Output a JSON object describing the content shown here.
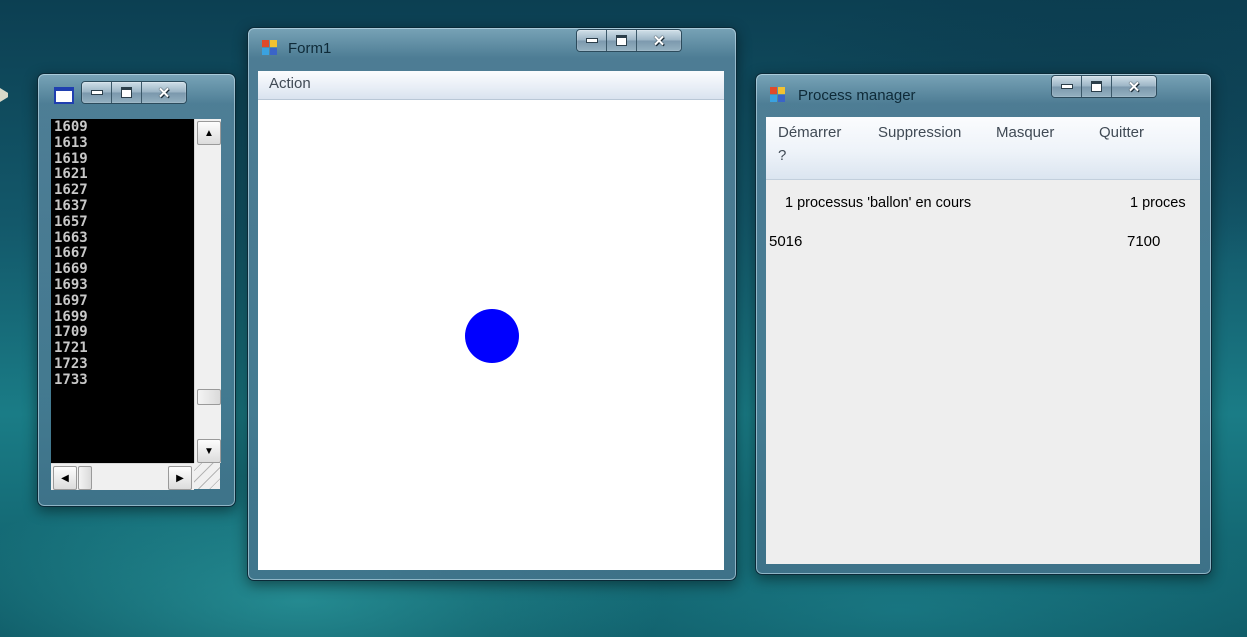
{
  "console": {
    "title_buttons": {
      "minimize": "minimize",
      "maximize": "maximize",
      "close": "close"
    },
    "lines": [
      "1609",
      "1613",
      "1619",
      "1621",
      "1627",
      "1637",
      "1657",
      "1663",
      "1667",
      "1669",
      "1693",
      "1697",
      "1699",
      "1709",
      "1721",
      "1723",
      "1733"
    ]
  },
  "form1": {
    "title": "Form1",
    "menu": {
      "action": "Action"
    },
    "ball": {
      "color": "#0000ff"
    }
  },
  "process_manager": {
    "title": "Process manager",
    "menu": {
      "start": "Démarrer",
      "delete": "Suppression",
      "hide": "Masquer",
      "quit": "Quitter",
      "help": "?"
    },
    "status_left": "1 processus 'ballon' en cours",
    "status_right": "1 proces",
    "pid_left": "5016",
    "pid_right": "7100"
  },
  "colors": {
    "desktop": "#13586a",
    "ball": "#0000ff",
    "console_bg": "#000000",
    "console_text": "#c8c8c8"
  }
}
